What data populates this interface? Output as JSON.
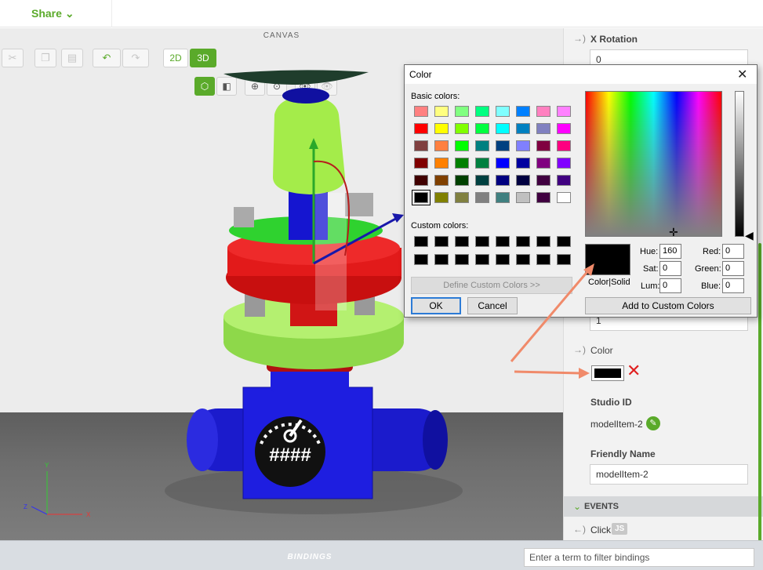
{
  "topbar": {
    "share_label": "Share"
  },
  "canvas": {
    "title": "CANVAS",
    "btn_2d": "2D",
    "btn_3d": "3D",
    "gauge_text": "####"
  },
  "panel": {
    "x_rotation_label": "X Rotation",
    "x_rotation_value": "0",
    "hidden_field_value": "1",
    "color_label": "Color",
    "color_value": "#000000",
    "studio_id_label": "Studio ID",
    "studio_id_value": "modelItem-2",
    "friendly_name_label": "Friendly Name",
    "friendly_name_value": "modelItem-2",
    "events_label": "EVENTS",
    "click_label": "Click",
    "js_badge": "JS"
  },
  "bottombar": {
    "label": "BINDINGS",
    "filter_placeholder": "Enter a term to filter bindings"
  },
  "dialog": {
    "title": "Color",
    "basic_colors_label": "Basic colors:",
    "custom_colors_label": "Custom colors:",
    "define_custom_label": "Define Custom Colors >>",
    "ok_label": "OK",
    "cancel_label": "Cancel",
    "preview_label": "Color|Solid",
    "hue_label": "Hue:",
    "hue_value": "160",
    "sat_label": "Sat:",
    "sat_value": "0",
    "lum_label": "Lum:",
    "lum_value": "0",
    "red_label": "Red:",
    "red_value": "0",
    "green_label": "Green:",
    "green_value": "0",
    "blue_label": "Blue:",
    "blue_value": "0",
    "add_custom_label": "Add to Custom Colors",
    "basic_colors": [
      "#ff8080",
      "#ffff80",
      "#80ff80",
      "#00ff80",
      "#80ffff",
      "#0080ff",
      "#ff80c0",
      "#ff80ff",
      "#ff0000",
      "#ffff00",
      "#80ff00",
      "#00ff40",
      "#00ffff",
      "#0080c0",
      "#8080c0",
      "#ff00ff",
      "#804040",
      "#ff8040",
      "#00ff00",
      "#008080",
      "#004080",
      "#8080ff",
      "#800040",
      "#ff0080",
      "#800000",
      "#ff8000",
      "#008000",
      "#008040",
      "#0000ff",
      "#0000a0",
      "#800080",
      "#8000ff",
      "#400000",
      "#804000",
      "#004000",
      "#004040",
      "#000080",
      "#000040",
      "#400040",
      "#400080",
      "#000000",
      "#808000",
      "#808040",
      "#808080",
      "#408080",
      "#c0c0c0",
      "#400040",
      "#ffffff"
    ],
    "custom_colors": [
      "#000000",
      "#000000",
      "#000000",
      "#000000",
      "#000000",
      "#000000",
      "#000000",
      "#000000",
      "#000000",
      "#000000",
      "#000000",
      "#000000",
      "#000000",
      "#000000",
      "#000000",
      "#000000"
    ]
  },
  "colors": {
    "accent": "#5aaa2a",
    "annotation_arrow": "#f08a6a",
    "delete_x": "#e02020"
  }
}
